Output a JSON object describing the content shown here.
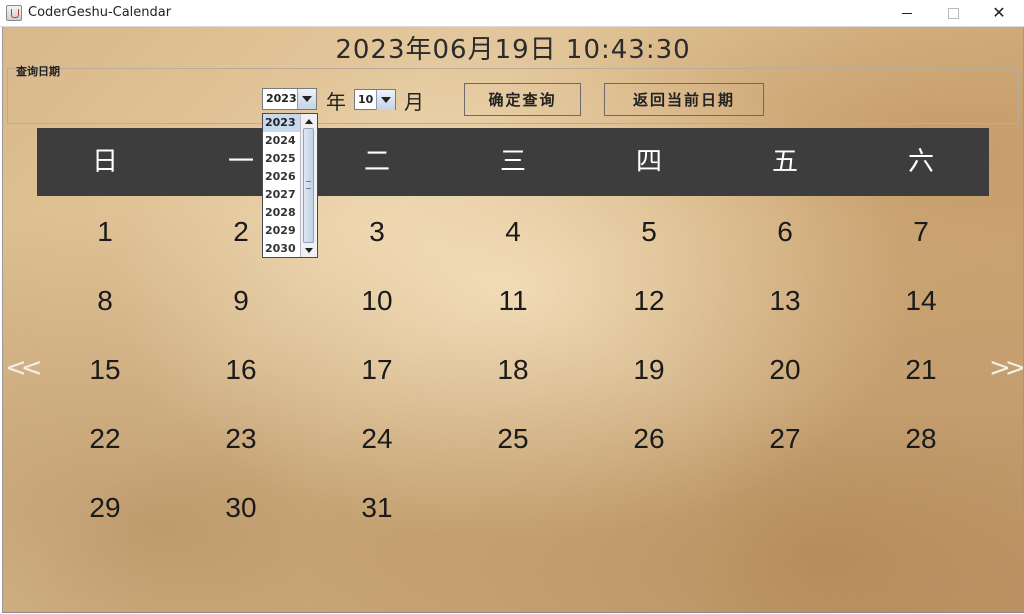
{
  "window": {
    "title": "CoderGeshu-Calendar"
  },
  "clock": "2023年06月19日  10:43:30",
  "query": {
    "legend": "查询日期",
    "year_value": "2023",
    "year_label": "年",
    "month_value": "10",
    "month_label": "月",
    "query_button": "确定查询",
    "today_button": "返回当前日期"
  },
  "year_dropdown": {
    "items": [
      "2023",
      "2024",
      "2025",
      "2026",
      "2027",
      "2028",
      "2029",
      "2030"
    ],
    "selected": "2023"
  },
  "weekdays": [
    "日",
    "一",
    "二",
    "三",
    "四",
    "五",
    "六"
  ],
  "days": [
    "1",
    "2",
    "3",
    "4",
    "5",
    "6",
    "7",
    "8",
    "9",
    "10",
    "11",
    "12",
    "13",
    "14",
    "15",
    "16",
    "17",
    "18",
    "19",
    "20",
    "21",
    "22",
    "23",
    "24",
    "25",
    "26",
    "27",
    "28",
    "29",
    "30",
    "31"
  ],
  "nav": {
    "prev": "<<",
    "next": ">>"
  },
  "colors": {
    "header_bg": "#3d3d3d",
    "header_text": "#ffffff",
    "selection": "#c7d9ec"
  }
}
